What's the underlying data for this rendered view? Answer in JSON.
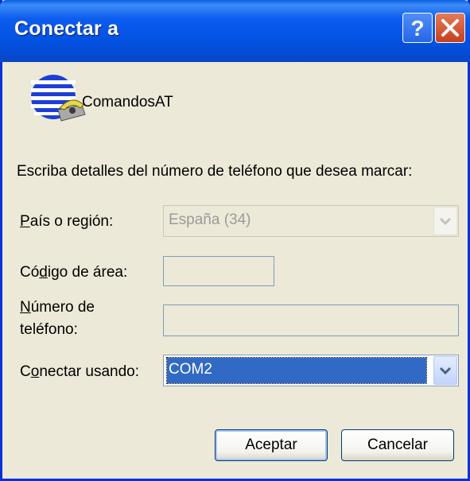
{
  "window": {
    "title": "Conectar a"
  },
  "titlebar_buttons": {
    "help": "?",
    "close_icon": "close-icon"
  },
  "connection": {
    "name": "ComandosAT",
    "icon": "phone-globe-icon"
  },
  "instructions": "Escriba detalles del número de teléfono que desea marcar:",
  "fields": {
    "country": {
      "label": "País o región:",
      "value": "España (34)"
    },
    "area_code": {
      "label": "Código de área:",
      "value": ""
    },
    "phone_number": {
      "label_line1": "Número de",
      "label_line2": "teléfono:",
      "value": ""
    },
    "connect_using": {
      "label": "Conectar usando:",
      "value": "COM2"
    }
  },
  "buttons": {
    "ok": "Aceptar",
    "cancel": "Cancelar"
  },
  "colors": {
    "titlebar": "#0350e0",
    "window_bg": "#ece9d8",
    "selection": "#316ac5"
  }
}
